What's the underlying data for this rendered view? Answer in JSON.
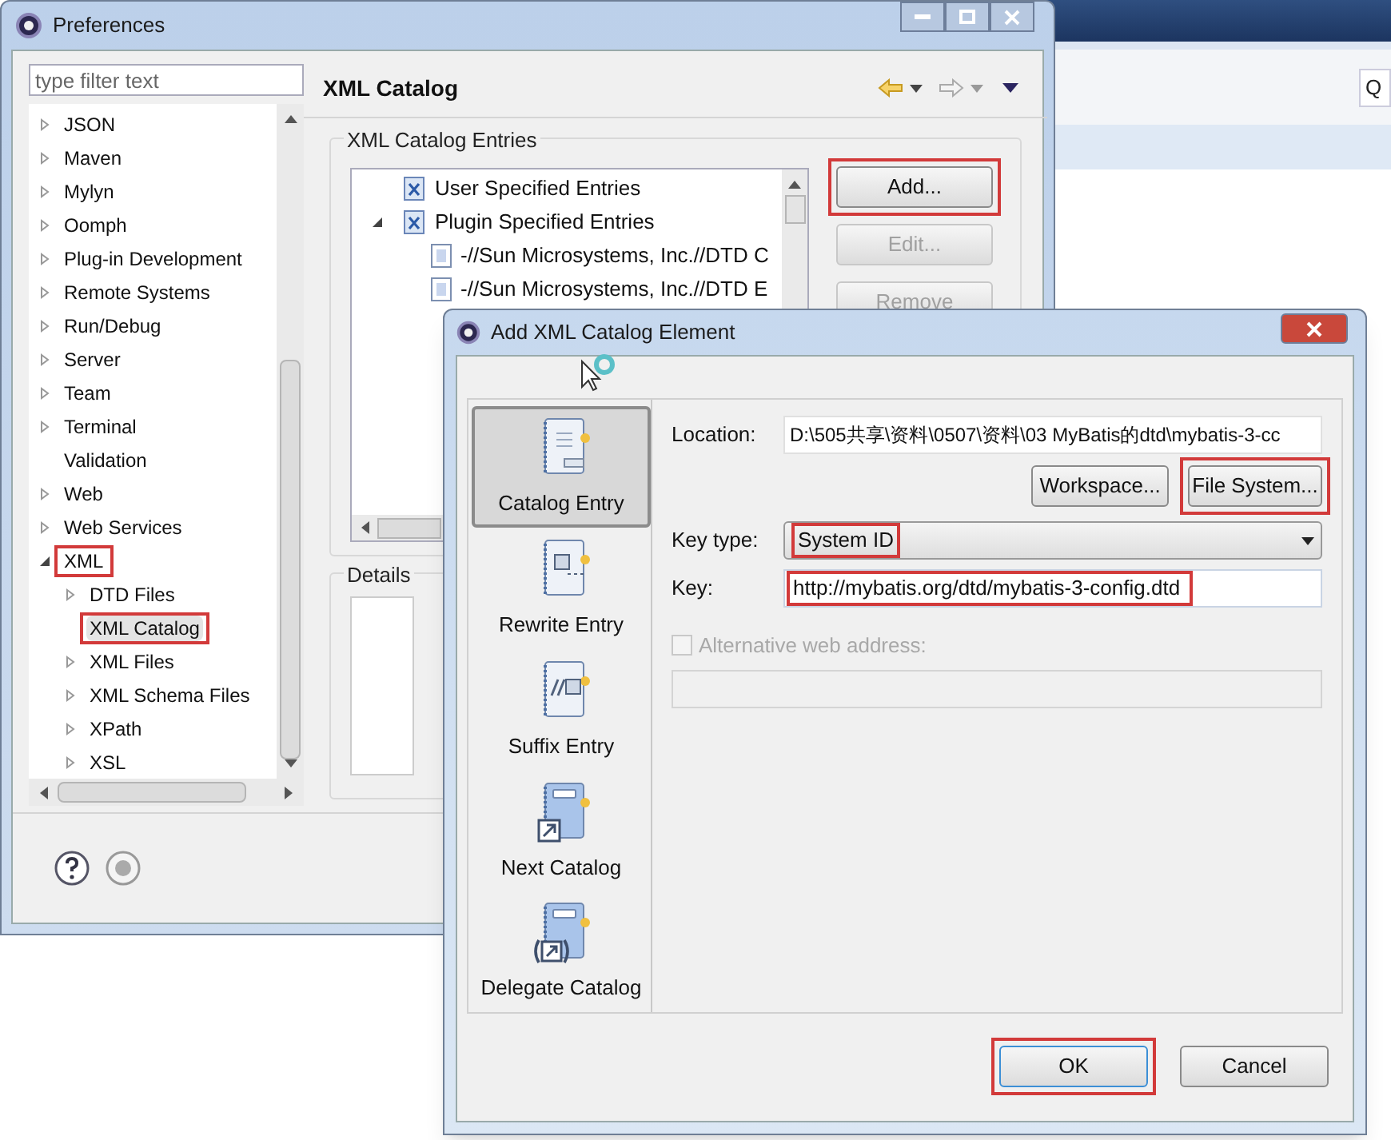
{
  "background_window": {
    "search_field": {
      "value": "Q"
    }
  },
  "preferences": {
    "title": "Preferences",
    "filter": {
      "placeholder": "type filter text"
    },
    "tree": [
      {
        "label": "JSON",
        "expanded": false
      },
      {
        "label": "Maven",
        "expanded": false
      },
      {
        "label": "Mylyn",
        "expanded": false
      },
      {
        "label": "Oomph",
        "expanded": false
      },
      {
        "label": "Plug-in Development",
        "expanded": false
      },
      {
        "label": "Remote Systems",
        "expanded": false
      },
      {
        "label": "Run/Debug",
        "expanded": false
      },
      {
        "label": "Server",
        "expanded": false
      },
      {
        "label": "Team",
        "expanded": false
      },
      {
        "label": "Terminal",
        "expanded": false
      },
      {
        "label": "Validation"
      },
      {
        "label": "Web",
        "expanded": false
      },
      {
        "label": "Web Services",
        "expanded": false
      },
      {
        "label": "XML",
        "expanded": true,
        "highlighted": true,
        "children": [
          {
            "label": "DTD Files",
            "expanded": false
          },
          {
            "label": "XML Catalog",
            "selected": true,
            "highlighted": true
          },
          {
            "label": "XML Files",
            "expanded": false
          },
          {
            "label": "XML Schema Files",
            "expanded": false
          },
          {
            "label": "XPath",
            "expanded": false
          },
          {
            "label": "XSL",
            "expanded": false
          }
        ]
      }
    ],
    "page_title": "XML Catalog",
    "entries_group": {
      "title": "XML Catalog Entries",
      "entries": [
        {
          "label": "User Specified Entries",
          "kind": "catalog"
        },
        {
          "label": "Plugin Specified Entries",
          "kind": "catalog",
          "expanded": true,
          "children": [
            {
              "label": "-//Sun Microsystems, Inc.//DTD C",
              "kind": "dtd"
            },
            {
              "label": "-//Sun Microsystems, Inc.//DTD E",
              "kind": "dtd"
            }
          ]
        }
      ],
      "buttons": [
        {
          "label": "Add...",
          "disabled": false,
          "highlighted": true
        },
        {
          "label": "Edit...",
          "disabled": true,
          "highlighted": false
        },
        {
          "label": "Remove",
          "disabled": true,
          "highlighted": false
        }
      ]
    },
    "details_group": {
      "title": "Details"
    }
  },
  "dialog": {
    "title": "Add XML Catalog Element",
    "sections": [
      {
        "label": "Catalog Entry",
        "kind": "catalog_entry",
        "selected": true
      },
      {
        "label": "Rewrite Entry",
        "kind": "rewrite",
        "selected": false
      },
      {
        "label": "Suffix Entry",
        "kind": "suffix",
        "selected": false
      },
      {
        "label": "Next Catalog",
        "kind": "next",
        "selected": false
      },
      {
        "label": "Delegate Catalog",
        "kind": "delegate",
        "selected": false
      }
    ],
    "location": {
      "label": "Location:",
      "value": "D:\\505共享\\资料\\0507\\资料\\03 MyBatis的dtd\\mybatis-3-cc"
    },
    "location_buttons": [
      {
        "label": "Workspace...",
        "highlighted": false
      },
      {
        "label": "File System...",
        "highlighted": true
      }
    ],
    "key_type": {
      "label": "Key type:",
      "value": "System ID",
      "highlighted": true
    },
    "key": {
      "label": "Key:",
      "value": "http://mybatis.org/dtd/mybatis-3-config.dtd",
      "highlighted": true
    },
    "alternative": {
      "label": "Alternative web address:",
      "checked": false,
      "disabled": true
    },
    "buttons": [
      {
        "label": "OK",
        "default": true,
        "highlighted": true
      },
      {
        "label": "Cancel",
        "default": false,
        "highlighted": false
      }
    ]
  }
}
